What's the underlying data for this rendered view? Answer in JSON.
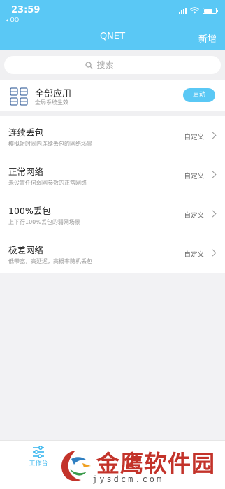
{
  "status_bar": {
    "time": "23:59",
    "back_app": "◂ QQ"
  },
  "header": {
    "title": "QNET",
    "add_label": "新增"
  },
  "search": {
    "placeholder": "搜索"
  },
  "all_apps": {
    "title": "全部应用",
    "subtitle": "全局系统生效",
    "button_label": "启动"
  },
  "profiles": [
    {
      "name": "连续丢包",
      "description": "模拟短时间内连续丢包的网络场景",
      "action": "自定义"
    },
    {
      "name": "正常网络",
      "description": "未设置任何弱网参数的正常网络",
      "action": "自定义"
    },
    {
      "name": "100%丢包",
      "description": "上下行100%丢包的弱网场景",
      "action": "自定义"
    },
    {
      "name": "极差网络",
      "description": "低带宽，高延迟，高概率随机丢包",
      "action": "自定义"
    }
  ],
  "tabbar": {
    "tabs": [
      {
        "label": "工作台",
        "icon": "sliders-icon",
        "active": true
      }
    ]
  },
  "watermark": {
    "text": "金鹰软件园",
    "url": "jysdcm.com"
  },
  "colors": {
    "accent": "#5ac8f5",
    "background": "#f0f0f2",
    "watermark_red": "#c3332a"
  }
}
